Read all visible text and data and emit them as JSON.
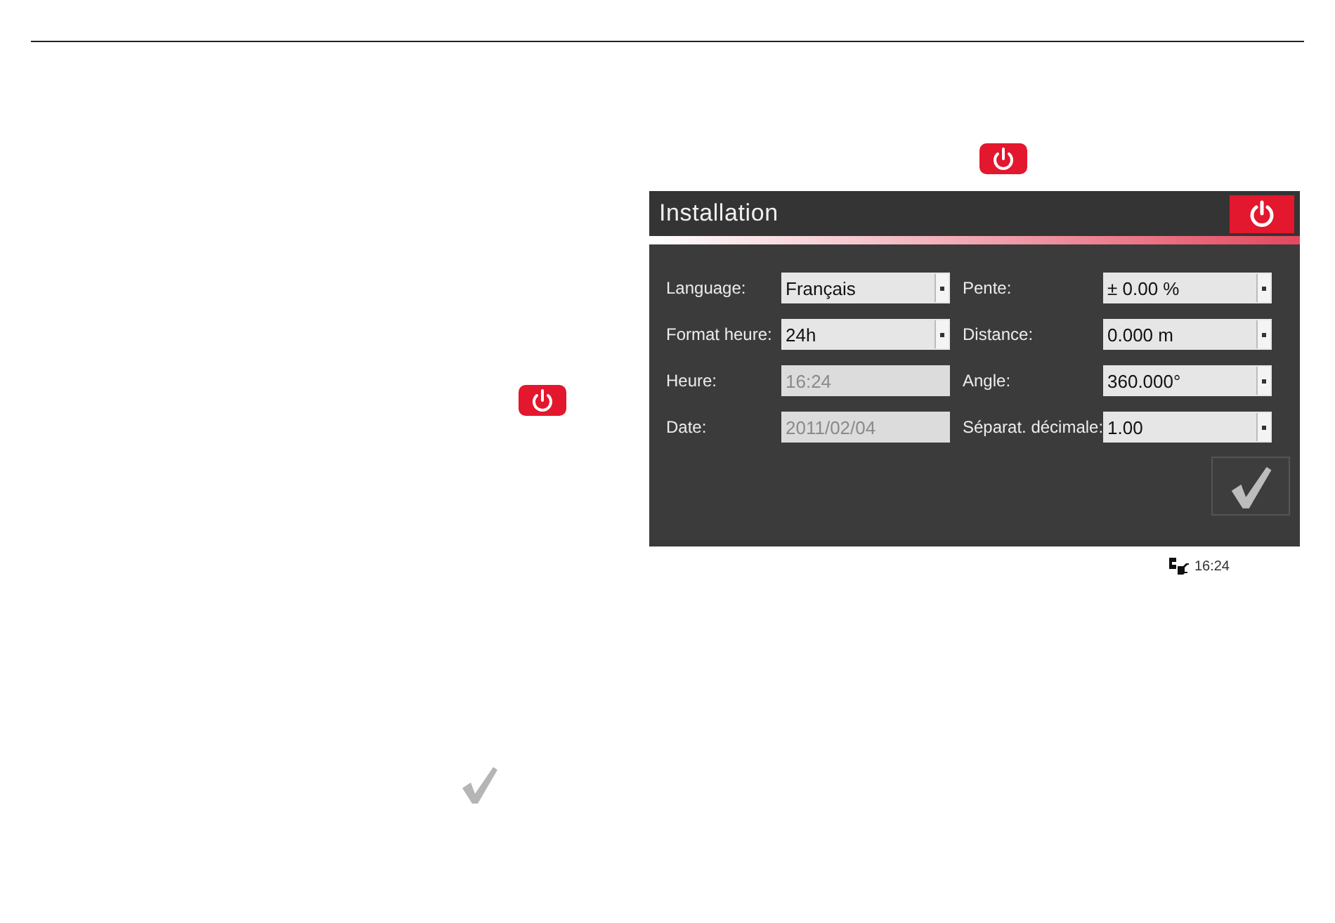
{
  "window": {
    "title": "Installation"
  },
  "settings": [
    {
      "label": "Language:",
      "value": "Français",
      "kind": "dropdown",
      "disabled": false
    },
    {
      "label": "Pente:",
      "value": "± 0.00 %",
      "kind": "dropdown",
      "disabled": false
    },
    {
      "label": "Format heure:",
      "value": "24h",
      "kind": "dropdown",
      "disabled": false
    },
    {
      "label": "Distance:",
      "value": "0.000 m",
      "kind": "dropdown",
      "disabled": false
    },
    {
      "label": "Heure:",
      "value": "16:24",
      "kind": "text",
      "disabled": true
    },
    {
      "label": "Angle:",
      "value": "360.000°",
      "kind": "dropdown",
      "disabled": false
    },
    {
      "label": "Date:",
      "value": "2011/02/04",
      "kind": "text",
      "disabled": true
    },
    {
      "label": "Séparat. décimale:",
      "value": "1.00",
      "kind": "dropdown",
      "disabled": false
    }
  ],
  "status_bar": {
    "time": "16:24"
  }
}
